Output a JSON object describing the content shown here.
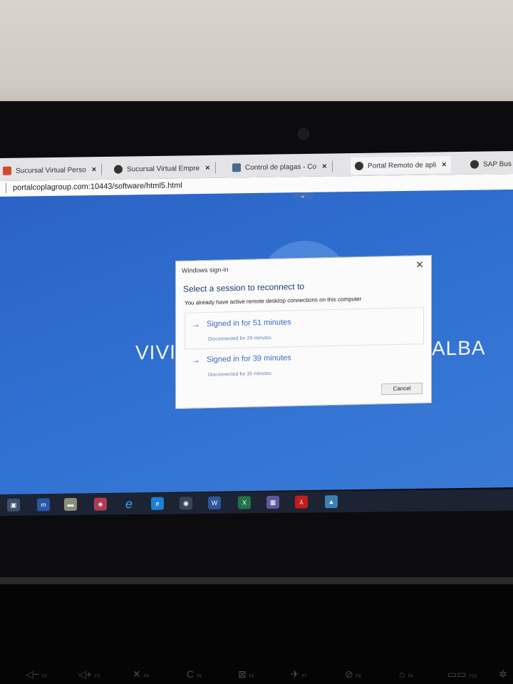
{
  "browser": {
    "tabs": [
      {
        "label": "Sucursal Virtual Perso",
        "close": "×"
      },
      {
        "label": "Sucursal Virtual Empre",
        "close": "×"
      },
      {
        "label": "Control de plagas - Co",
        "close": "×"
      },
      {
        "label": "Portal Remoto de apli",
        "close": "×"
      },
      {
        "label": "SAP Bus",
        "close": ""
      }
    ],
    "url": "portalcoplagroup.com:10443/software/html5.html"
  },
  "desktop": {
    "text_left": "VIVI",
    "text_right": "ALBA",
    "pulldown": "⌄"
  },
  "dialog": {
    "title": "Windows sign-in",
    "close": "✕",
    "heading": "Select a session to reconnect to",
    "subheading": "You already have active remote desktop connections on this computer",
    "sessions": [
      {
        "arrow": "→",
        "label": "Signed in for 51 minutes",
        "info": "Disconnected for 29 minutes"
      },
      {
        "arrow": "→",
        "label": "Signed in for 39 minutes",
        "info": "Disconnected for 35 minutes"
      }
    ],
    "cancel": "Cancel"
  },
  "taskbar": {
    "apps": [
      {
        "name": "store-icon",
        "glyph": "▣",
        "color": "#3d4e6e"
      },
      {
        "name": "app-m-icon",
        "glyph": "m",
        "color": "#2a56a8"
      },
      {
        "name": "app-folder-icon",
        "glyph": "▬",
        "color": "#8a8f7a"
      },
      {
        "name": "app-red-icon",
        "glyph": "◈",
        "color": "#b03a52"
      },
      {
        "name": "ie-icon",
        "glyph": "e",
        "color": "transparent"
      },
      {
        "name": "edge-icon",
        "glyph": "e",
        "color": "#1e7fd0"
      },
      {
        "name": "chrome-icon",
        "glyph": "◉",
        "color": "#e0e0e0"
      },
      {
        "name": "word-icon",
        "glyph": "W",
        "color": "#2b579a"
      },
      {
        "name": "excel-icon",
        "glyph": "X",
        "color": "#217346"
      },
      {
        "name": "app-grid-icon",
        "glyph": "▦",
        "color": "#5a5aa0"
      },
      {
        "name": "acrobat-icon",
        "glyph": "⅄",
        "color": "#c21d1d"
      },
      {
        "name": "app-photo-icon",
        "glyph": "▲",
        "color": "#3f7fb5"
      }
    ]
  },
  "keyboard": {
    "keys": [
      {
        "glyph": "◁−",
        "label": "F2"
      },
      {
        "glyph": "◁+",
        "label": "F3"
      },
      {
        "glyph": "✕",
        "label": "F4"
      },
      {
        "glyph": "C",
        "label": "F5"
      },
      {
        "glyph": "⊠",
        "label": "F6"
      },
      {
        "glyph": "✈",
        "label": "F7"
      },
      {
        "glyph": "⊘",
        "label": "F8"
      },
      {
        "glyph": "⌂",
        "label": "F9"
      },
      {
        "glyph": "▭▭",
        "label": "F10"
      },
      {
        "glyph": "✲",
        "label": ""
      }
    ]
  }
}
